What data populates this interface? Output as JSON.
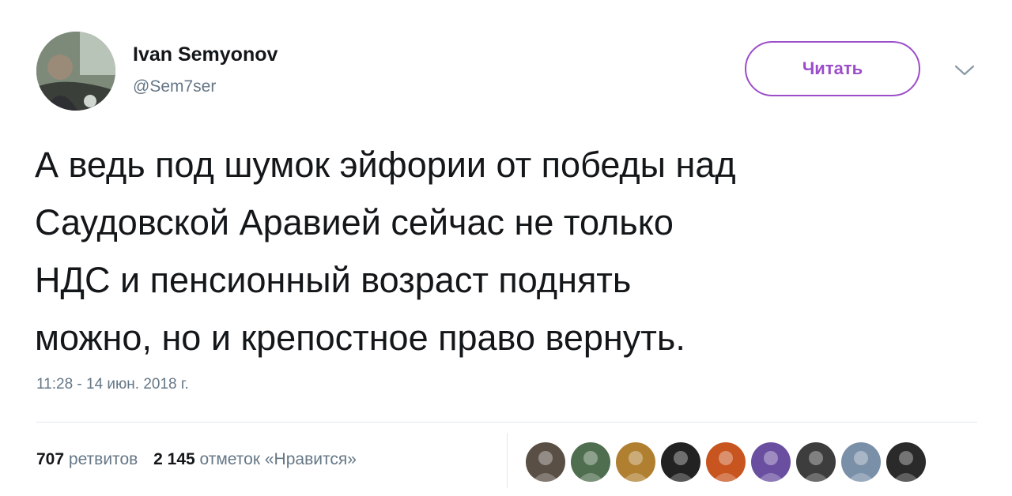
{
  "author": {
    "name": "Ivan Semyonov",
    "handle": "@Sem7ser",
    "avatar_icon": "person-in-car-photo"
  },
  "follow_button": {
    "label": "Читать",
    "color": "#9b4dca"
  },
  "menu_icon": "chevron-down-icon",
  "tweet": {
    "lines": [
      "А ведь под шумок эйфории от победы над",
      "Саудовской Аравией сейчас не только",
      "НДС и пенсионный возраст поднять",
      "можно, но и крепостное право вернуть."
    ]
  },
  "timestamp": "11:28 - 14 июн. 2018 г.",
  "stats": {
    "retweets": {
      "count": "707",
      "label": "ретвитов"
    },
    "likes": {
      "count": "2 145",
      "label": "отметок «Нравится»"
    }
  },
  "likers": [
    {
      "icon": "user-avatar-1",
      "color": "#5a4f45"
    },
    {
      "icon": "user-avatar-2",
      "color": "#4f6e4f"
    },
    {
      "icon": "user-avatar-3",
      "color": "#b08030"
    },
    {
      "icon": "user-avatar-4",
      "color": "#222222"
    },
    {
      "icon": "user-avatar-5",
      "color": "#c8551f"
    },
    {
      "icon": "user-avatar-6",
      "color": "#6a4fa0"
    },
    {
      "icon": "user-avatar-7",
      "color": "#3d3d3d"
    },
    {
      "icon": "user-avatar-8",
      "color": "#7a8fa8"
    },
    {
      "icon": "user-avatar-9",
      "color": "#2a2a2a"
    }
  ]
}
